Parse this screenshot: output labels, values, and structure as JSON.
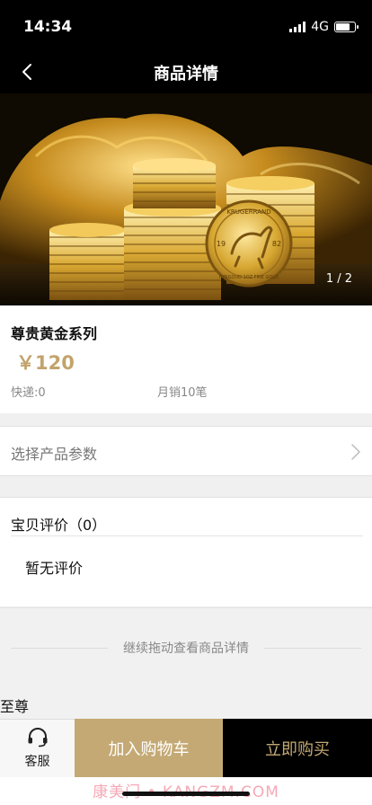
{
  "status_bar": {
    "time": "14:34",
    "network": "4G",
    "battery_level": 0.75
  },
  "nav": {
    "title": "商品详情",
    "back_icon": "chevron-left-icon"
  },
  "hero": {
    "pager": "1 / 2",
    "coin_text_top": "KRUGERRAND",
    "coin_text_left": "19",
    "coin_text_right": "82",
    "coin_text_bottom": "FYNGOUD 1OZ FINE GOLD"
  },
  "product": {
    "name": "尊贵黄金系列",
    "price": "￥120",
    "shipping": "快递:0",
    "monthly_sales": "月销10笔"
  },
  "params": {
    "label": "选择产品参数",
    "arrow_icon": "chevron-right-icon"
  },
  "reviews": {
    "title": "宝贝评价（0）",
    "empty_text": "暂无评价"
  },
  "detail_section": {
    "drag_hint": "继续拖动查看商品详情",
    "content_text": "至尊"
  },
  "bottom_bar": {
    "service_icon": "headset-icon",
    "service_label": "客服",
    "add_to_cart": "加入购物车",
    "buy_now": "立即购买"
  },
  "watermark": "康美门 • KANGZM.COM",
  "colors": {
    "gold_accent": "#c4a974",
    "price_color": "#c2a36c",
    "header_bg": "#000000"
  }
}
